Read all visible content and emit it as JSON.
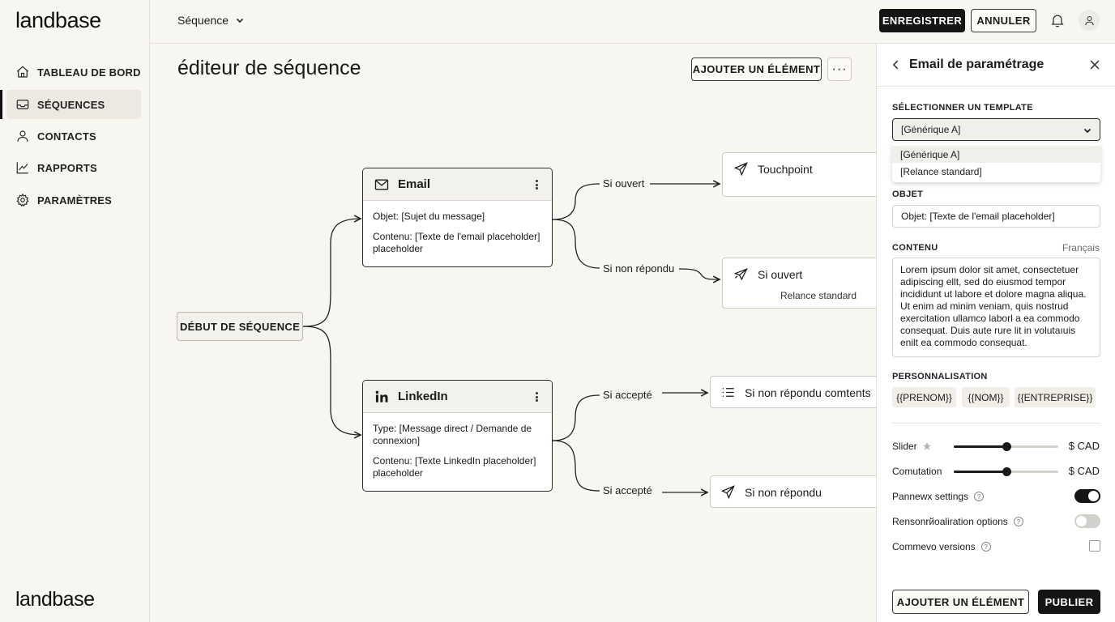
{
  "brand": {
    "name": "landbase"
  },
  "sidebar": {
    "items": [
      {
        "label": "TABLEAU DE BORD",
        "icon": "home-icon"
      },
      {
        "label": "SÉQUENCES",
        "icon": "inbox-icon",
        "active": true
      },
      {
        "label": "CONTACTS",
        "icon": "user-icon"
      },
      {
        "label": "RAPPORTS",
        "icon": "chart-line-icon"
      },
      {
        "label": "PARAMÈTRES",
        "icon": "gear-icon"
      }
    ]
  },
  "topbar": {
    "breadcrumb": "Séquence",
    "save_label": "ENREGISTRER",
    "cancel_label": "ANNULER"
  },
  "main": {
    "title": "éditeur de séquence",
    "add_element_label": "AJOUTER UN ÉLÉMENT",
    "more_label": "···"
  },
  "canvas": {
    "start_label": "DÉBUT DE SÉQUENCE",
    "email_card": {
      "title": "Email",
      "subject": "Objet: [Sujet du message]",
      "content": "Contenu: [Texte de l'email placeholder] placeholder"
    },
    "linkedin_card": {
      "title": "LinkedIn",
      "type": "Type: [Message direct / Demande de connexion]",
      "content": "Contenu: [Texte LinkedIn placeholder] placeholder"
    },
    "branches": {
      "email_opened": "Si ouvert",
      "email_no_reply": "Si non répondu",
      "linkedin_accepted_1": "Si accepté",
      "linkedin_accepted_2": "Si accepté"
    },
    "nodes": {
      "touchpoint": {
        "title": "Touchpoint"
      },
      "opened": {
        "title": "Si ouvert",
        "subtitle": "Relance standard"
      },
      "no_reply_comments": {
        "title": "Si non répondu comtents"
      },
      "no_reply": {
        "title": "Si non répondu"
      }
    }
  },
  "panel": {
    "title": "Email de paramétrage",
    "template": {
      "label": "SÉLECTIONNER UN TEMPLATE",
      "value": "[Générique A]",
      "options": [
        "[Générique A]",
        "[Relance standard]"
      ]
    },
    "subject": {
      "label": "OBJET",
      "value": "Objet: [Texte de l'email placeholder]"
    },
    "content": {
      "label": "CONTENU",
      "language": "Français",
      "value": "Lorem ipsum dolor sit amet, consectetuer adipiscing ellt, sed do eiusmod tempor incididunt ut labore et dolore magna aliqua. Ut enim ad minim veniam, quis nostrud exercitation ullamco laborl a ea commodo consequat. Duis aute rure lit in volutaıuis enilt ea commodo consequat."
    },
    "personalization": {
      "label": "PERSONNALISATION",
      "tokens": [
        "{{PRENOM}}",
        "{{NOM}}",
        "{{ENTREPRISE}}"
      ]
    },
    "settings": {
      "slider": {
        "label": "Slider",
        "unit": "$ CAD",
        "value_pct": 50
      },
      "comutation": {
        "label": "Comutation",
        "unit": "$ CAD",
        "value_pct": 50
      },
      "pannewx": {
        "label": "Pannewx settings",
        "on": true
      },
      "rensonr": {
        "label": "Rensonrйoalіration options",
        "on": false
      },
      "commevo": {
        "label": "Commevo versions",
        "checked": false
      }
    },
    "footer": {
      "add_label": "AJOUTER UN ÉLÉMENT",
      "publish_label": "PUBLIER"
    }
  },
  "colors": {
    "accent": "#151515",
    "background": "#f7f6f1",
    "panel": "#ffffff"
  }
}
